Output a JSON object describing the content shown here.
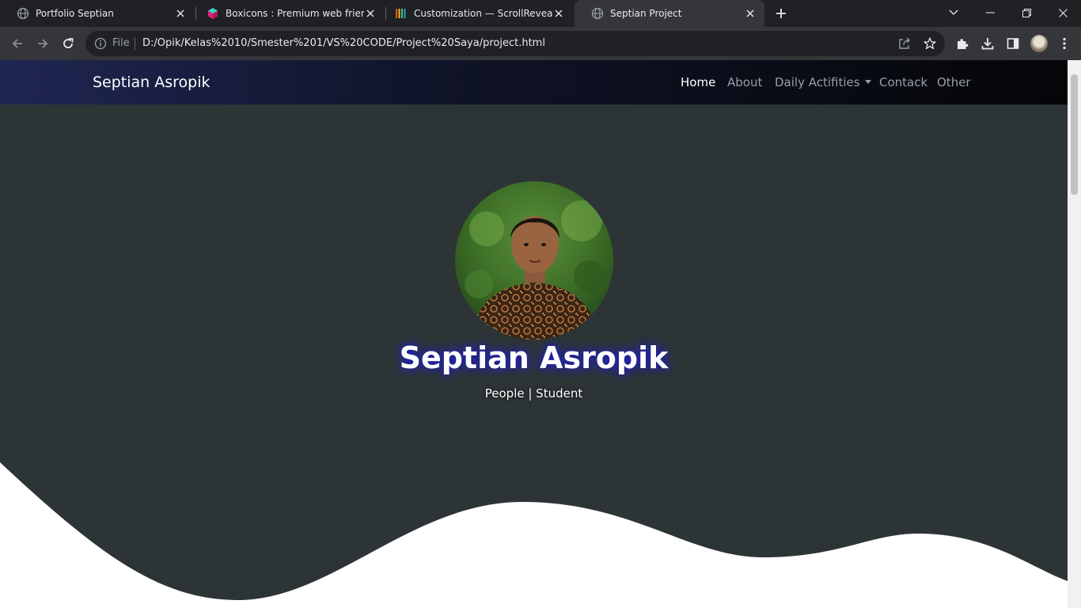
{
  "browser": {
    "tabs": [
      {
        "title": "Portfolio Septian",
        "favicon": "globe-icon",
        "active": false
      },
      {
        "title": "Boxicons : Premium web friendly",
        "favicon": "boxicons-logo-icon",
        "active": false
      },
      {
        "title": "Customization — ScrollReveal",
        "favicon": "scrollreveal-logo-icon",
        "active": false
      },
      {
        "title": "Septian Project",
        "favicon": "globe-icon",
        "active": true
      }
    ],
    "omnibox": {
      "scheme_label": "File",
      "url": "D:/Opik/Kelas%2010/Smester%201/VS%20CODE/Project%20Saya/project.html"
    }
  },
  "site": {
    "brand": "Septian Asropik",
    "nav": [
      {
        "label": "Home",
        "active": true
      },
      {
        "label": "About",
        "active": false
      },
      {
        "label": "Daily Actifities",
        "active": false,
        "dropdown": true
      },
      {
        "label": "Contack",
        "active": false
      },
      {
        "label": "Other",
        "active": false
      }
    ],
    "hero": {
      "name": "Septian Asropik",
      "tagline": "People | Student"
    }
  },
  "colors": {
    "page_bg": "#2d3436",
    "wave": "#ffffff",
    "name_glow": "#1a1aa8",
    "nav_gradient_start": "#1f2652",
    "nav_gradient_end": "#050608"
  }
}
